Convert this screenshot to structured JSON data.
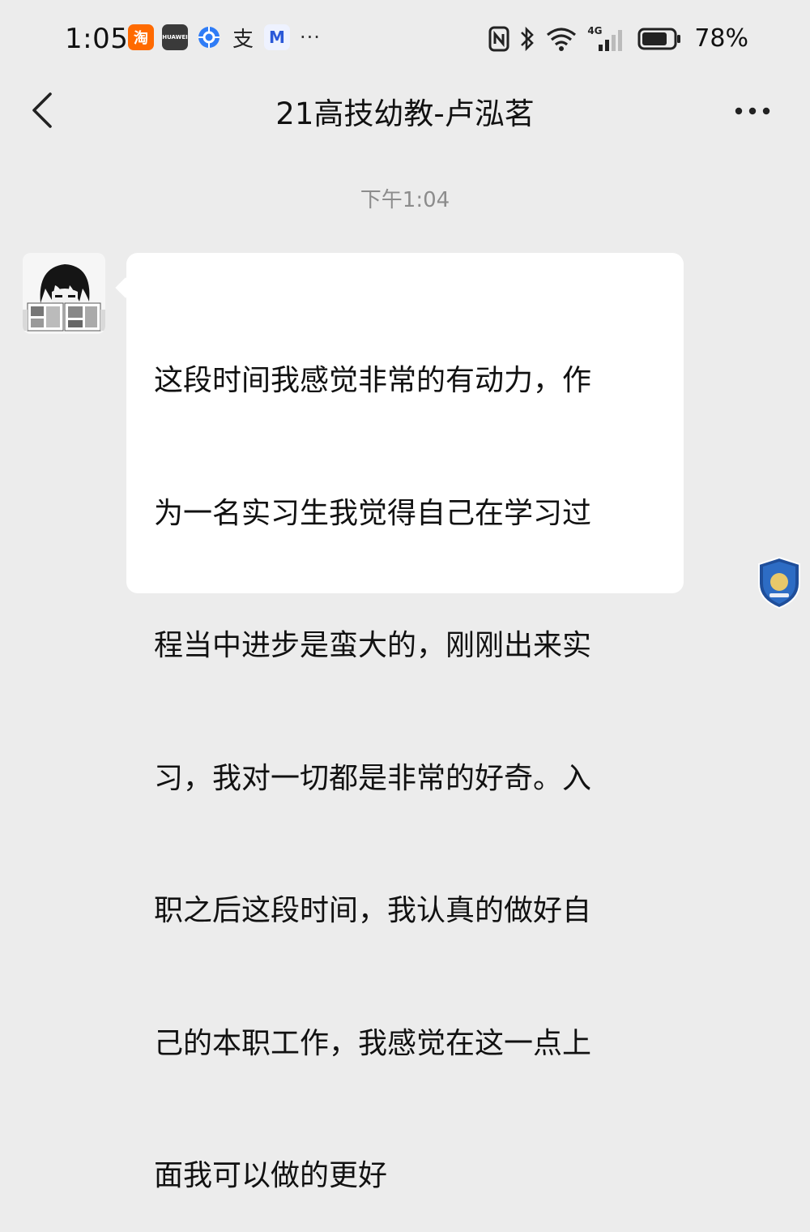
{
  "status_bar": {
    "time": "1:05",
    "notification_icons": [
      "taobao-icon",
      "huawei-icon",
      "browser-icon",
      "alipay-icon",
      "mail-icon"
    ],
    "more_indicator": "···",
    "taobao_glyph": "淘",
    "huawei_label": "HUAWEI",
    "alipay_glyph": "支",
    "mail_glyph": "M",
    "network_label": "4G",
    "battery_percent": "78%"
  },
  "header": {
    "title": "21高技幼教-卢泓茗"
  },
  "conversation": {
    "timestamp": "下午1:04",
    "messages": [
      {
        "sender": "other",
        "lines": [
          "这段时间我感觉非常的有动力，作",
          "为一名实习生我觉得自己在学习过",
          "程当中进步是蛮大的，刚刚出来实",
          "习，我对一切都是非常的好奇。入",
          "职之后这段时间，我认真的做好自",
          "己的本职工作，我感觉在这一点上",
          "面我可以做的更好"
        ]
      }
    ]
  },
  "colors": {
    "background": "#ececec",
    "bubble": "#ffffff",
    "timestamp": "#8c8c8c",
    "taobao": "#ff6a00",
    "browser": "#2f7cf6"
  }
}
